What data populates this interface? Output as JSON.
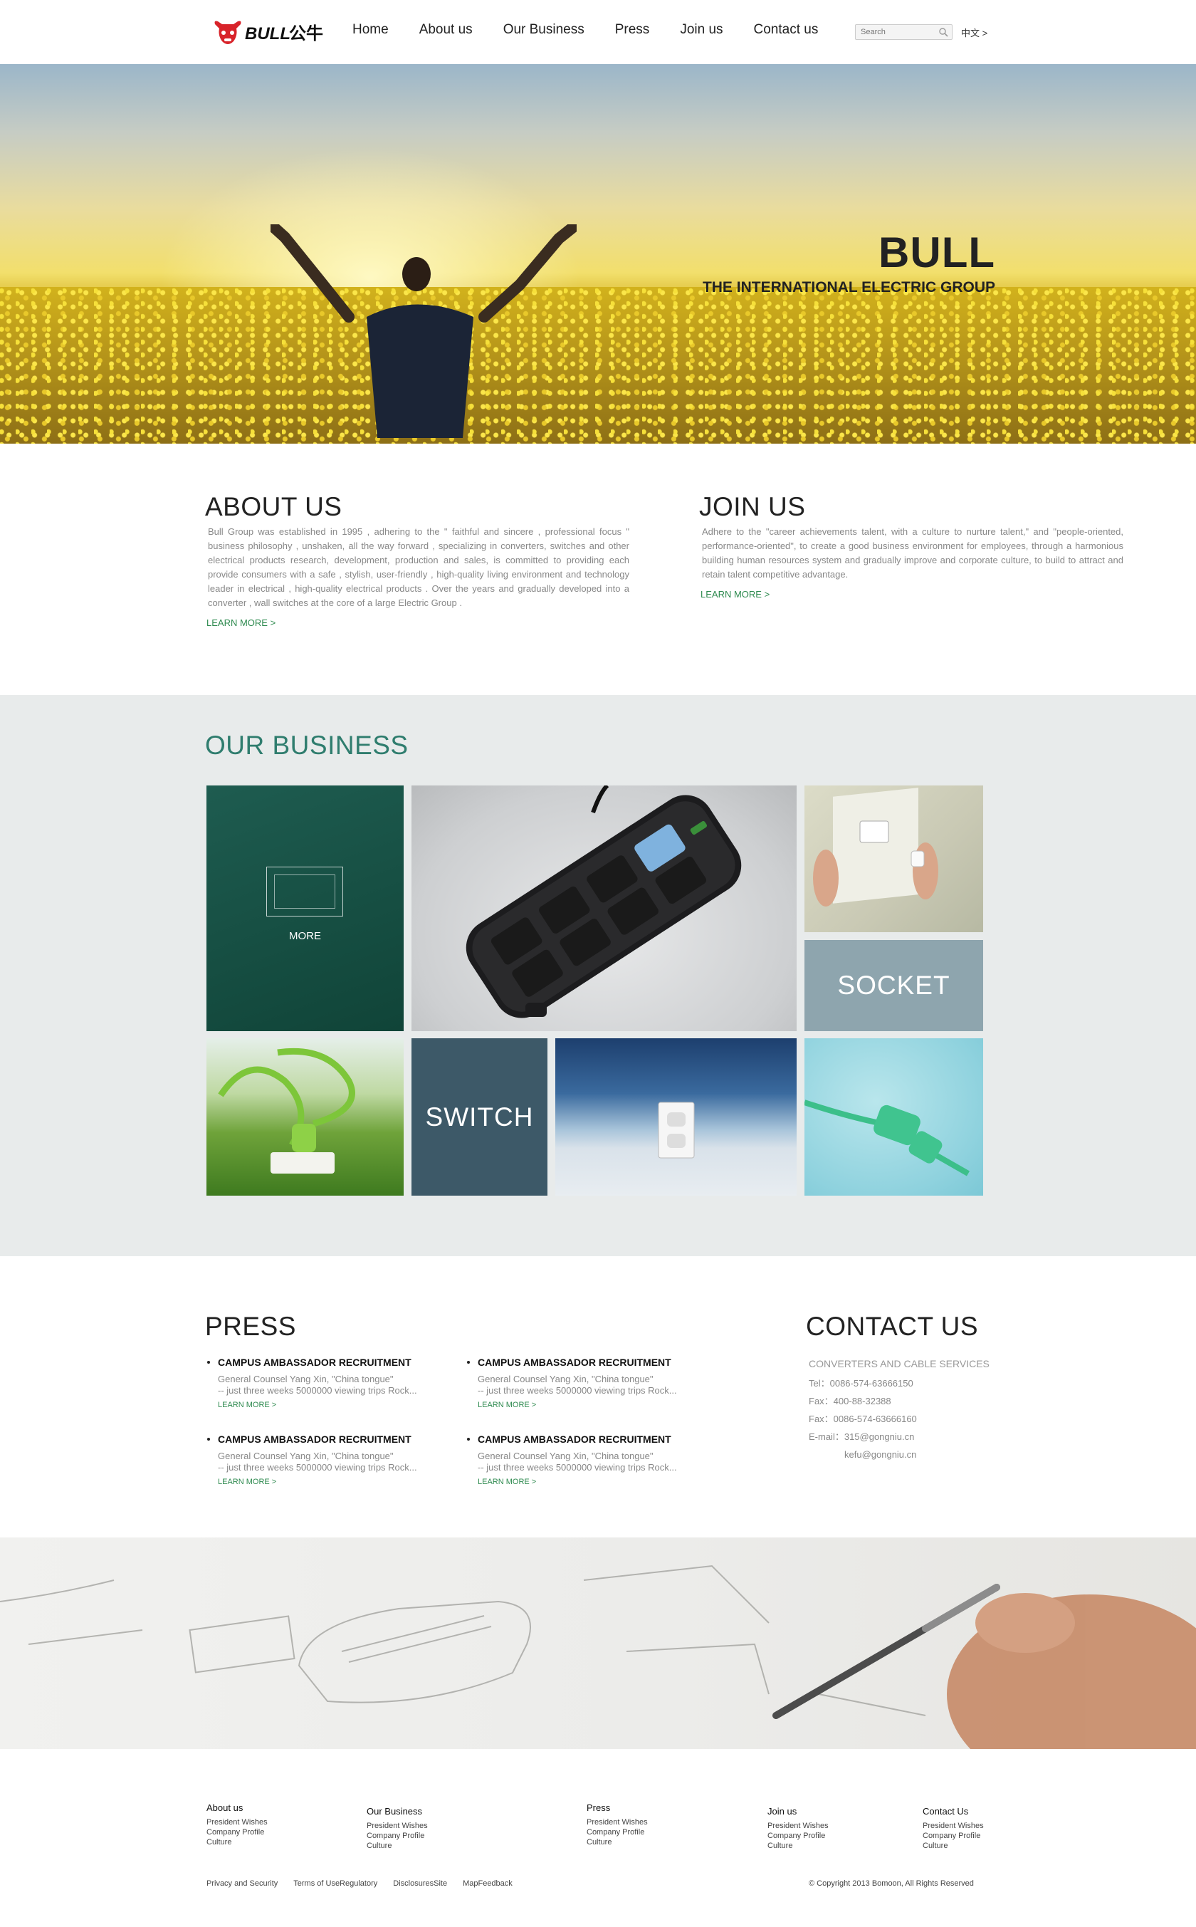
{
  "brand": {
    "logo_text": "BULL公牛"
  },
  "nav": {
    "items": [
      {
        "label": "Home"
      },
      {
        "label": "About us"
      },
      {
        "label": "Our Business"
      },
      {
        "label": "Press"
      },
      {
        "label": "Join us"
      },
      {
        "label": "Contact us"
      }
    ],
    "search_placeholder": "Search",
    "lang": "中文 >"
  },
  "hero": {
    "title": "BULL",
    "subtitle": "THE INTERNATIONAL ELECTRIC GROUP"
  },
  "about": {
    "heading": "ABOUT US",
    "text": "Bull Group was established in 1995 , adhering to the \" faithful and sincere , professional focus \" business philosophy , unshaken, all the way forward , specializing in converters, switches and other electrical products research, development, production and sales, is committed to providing each provide consumers with a safe , stylish, user-friendly , high-quality living environment and technology leader in electrical , high-quality electrical products . Over the years and gradually developed into a converter , wall switches at the core of a large Electric Group .",
    "more": "LEARN MORE >"
  },
  "join": {
    "heading": "JOIN US",
    "text": "Adhere to the \"career achievements talent, with a culture to nurture talent,\" and \"people-oriented, performance-oriented\", to create a good business environment for employees, through a harmonious building human resources system and gradually improve and corporate culture, to build to attract and retain talent competitive advantage.",
    "more": "LEARN MORE >"
  },
  "business": {
    "heading": "OUR BUSINESS",
    "more_label": "MORE",
    "socket_label": "SOCKET",
    "switch_label": "SWITCH"
  },
  "press": {
    "heading": "PRESS",
    "items": [
      {
        "title": "CAMPUS AMBASSADOR RECRUITMENT",
        "line1": "General Counsel Yang Xin, \"China tongue\"",
        "line2": "-- just three weeks 5000000 viewing trips Rock...",
        "more": "LEARN MORE >"
      },
      {
        "title": "CAMPUS AMBASSADOR RECRUITMENT",
        "line1": "General Counsel Yang Xin, \"China tongue\"",
        "line2": "-- just three weeks 5000000 viewing trips Rock...",
        "more": "LEARN MORE >"
      },
      {
        "title": "CAMPUS AMBASSADOR RECRUITMENT",
        "line1": "General Counsel Yang Xin, \"China tongue\"",
        "line2": "-- just three weeks 5000000 viewing trips Rock...",
        "more": "LEARN MORE >"
      },
      {
        "title": "CAMPUS AMBASSADOR RECRUITMENT",
        "line1": "General Counsel Yang Xin, \"China tongue\"",
        "line2": "-- just three weeks 5000000 viewing trips Rock...",
        "more": "LEARN MORE >"
      }
    ]
  },
  "contact": {
    "heading": "CONTACT US",
    "service": "CONVERTERS AND CABLE SERVICES",
    "tel": "Tel：0086-574-63666150",
    "fax1": "Fax：400-88-32388",
    "fax2": "Fax：0086-574-63666160",
    "email1": "E-mail：315@gongniu.cn",
    "email2": "kefu@gongniu.cn"
  },
  "footer": {
    "columns": [
      {
        "heading": "About us",
        "items": [
          "President Wishes",
          "Company Profile",
          "Culture"
        ]
      },
      {
        "heading": "Our Business",
        "items": [
          "President Wishes",
          "Company Profile",
          "Culture"
        ]
      },
      {
        "heading": "Press",
        "items": [
          "President Wishes",
          "Company Profile",
          "Culture"
        ]
      },
      {
        "heading": "Join us",
        "items": [
          "President Wishes",
          "Company Profile",
          "Culture"
        ]
      },
      {
        "heading": "Contact Us",
        "items": [
          "President Wishes",
          "Company Profile",
          "Culture"
        ]
      }
    ],
    "links": [
      "Privacy and Security",
      "Terms of UseRegulatory",
      "DisclosuresSite",
      "MapFeedback"
    ],
    "copyright": "© Copyright 2013 Bomoon, All Rights Reserved"
  }
}
